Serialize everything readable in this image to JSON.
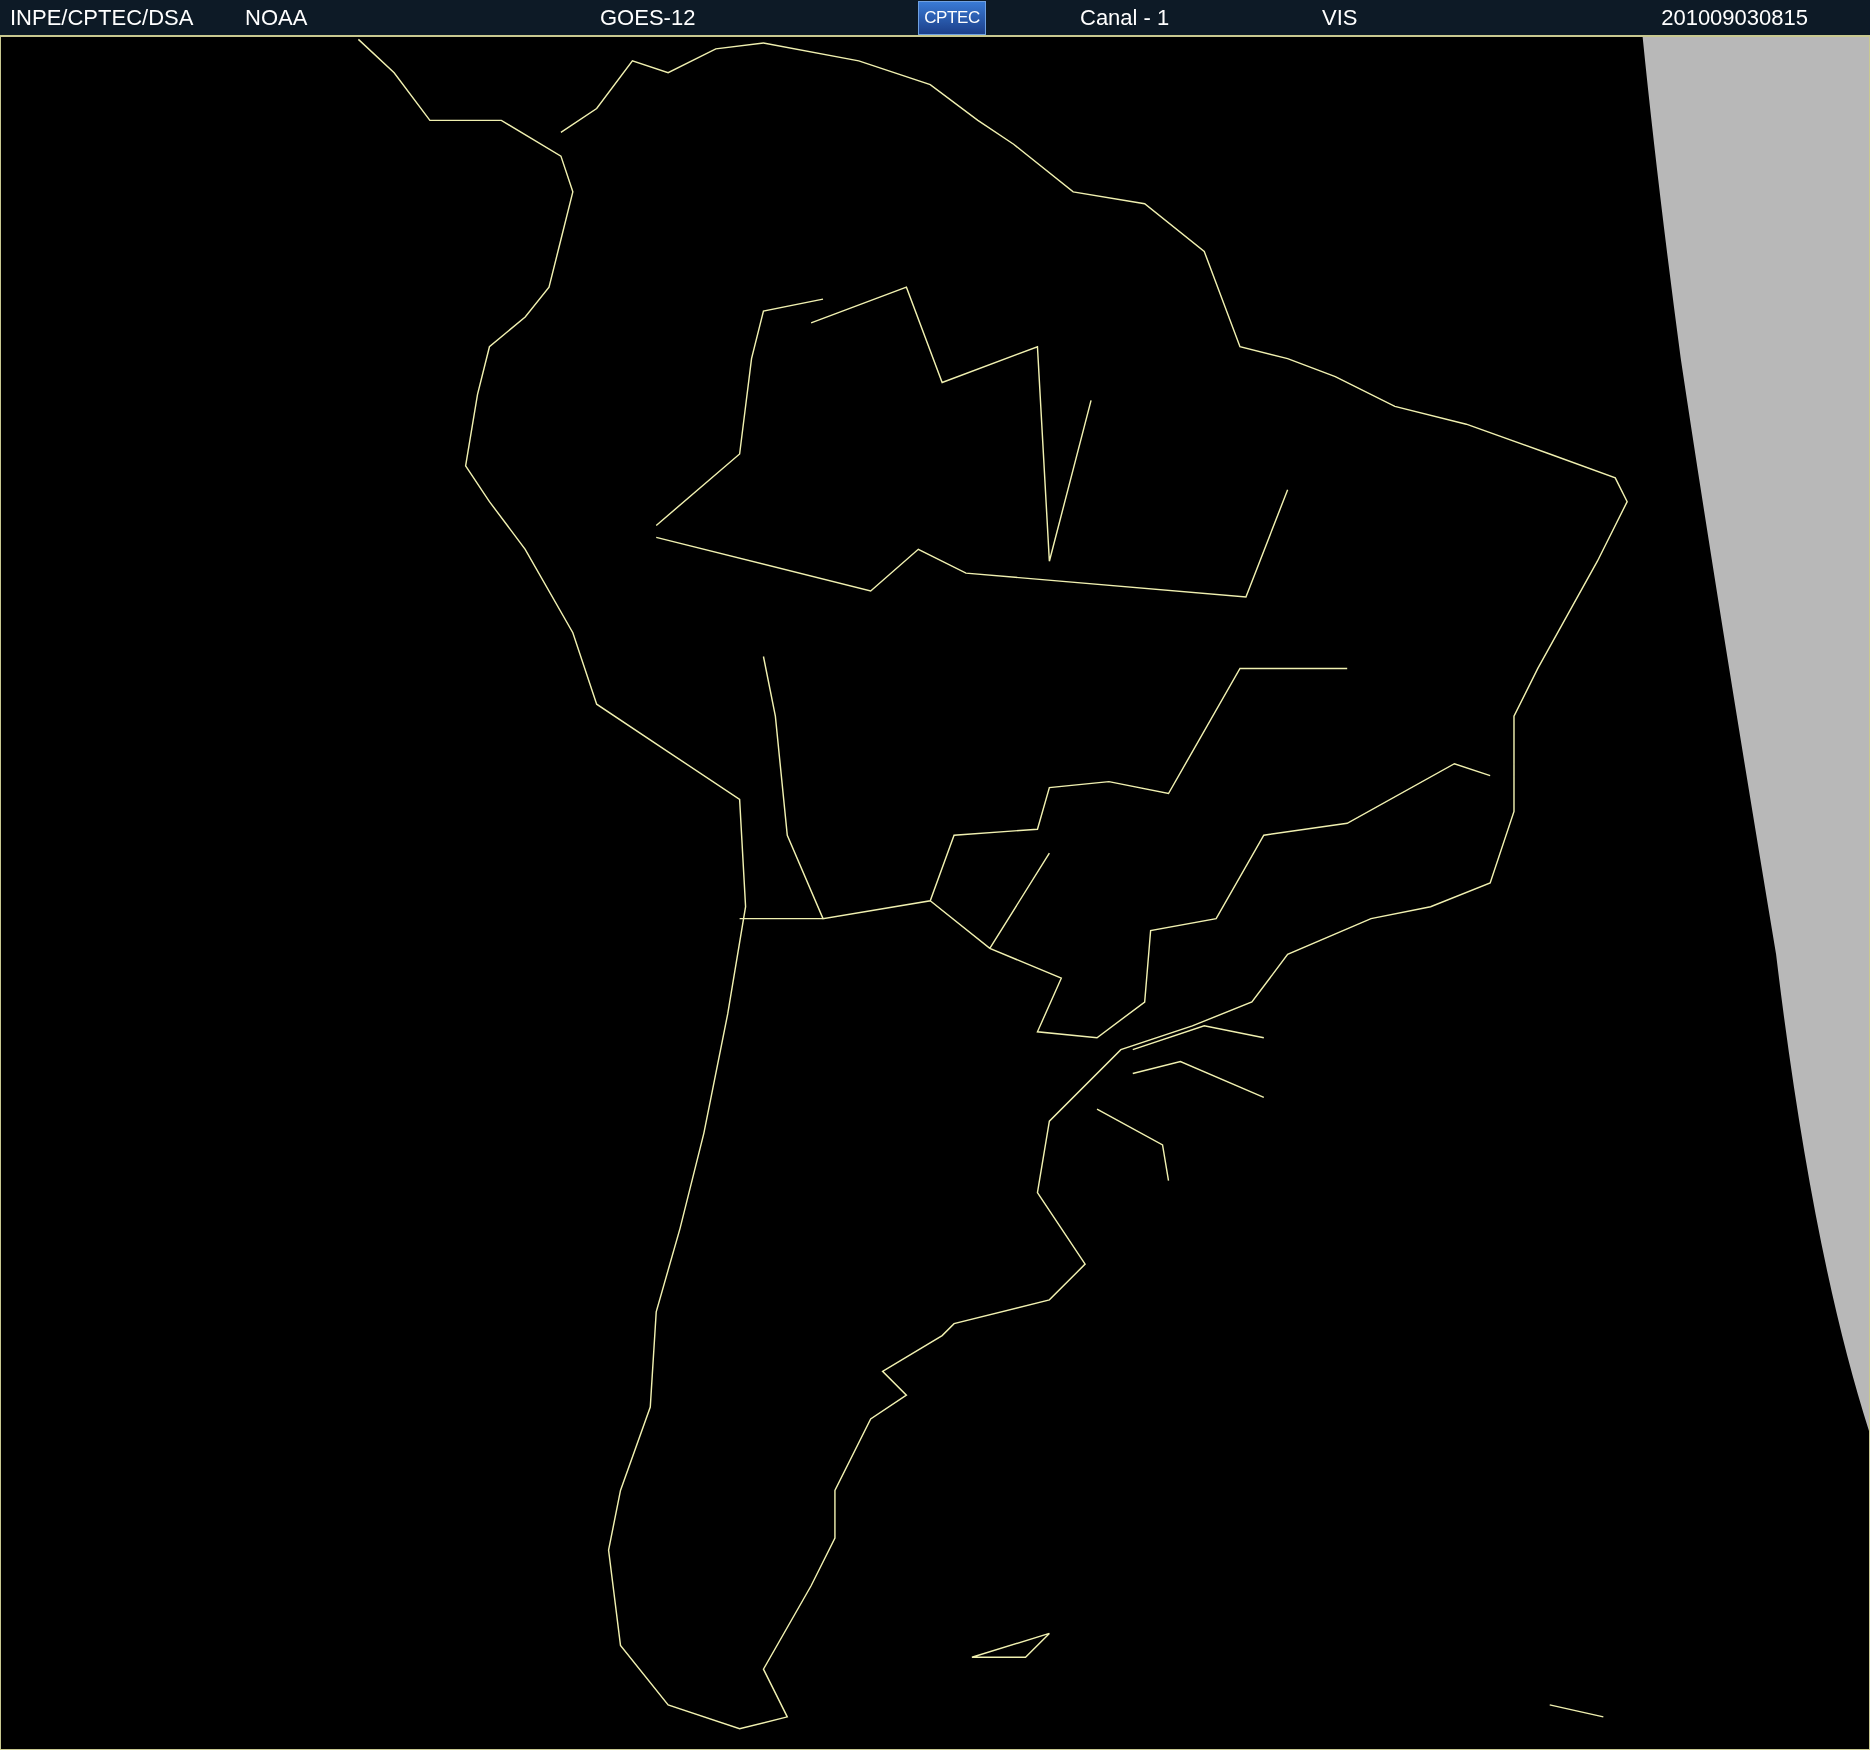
{
  "header": {
    "source": "INPE/CPTEC/DSA",
    "agency": "NOAA",
    "satellite": "GOES-12",
    "logo": "CPTEC",
    "channel": "Canal - 1",
    "band": "VIS",
    "timestamp": "201009030815"
  }
}
